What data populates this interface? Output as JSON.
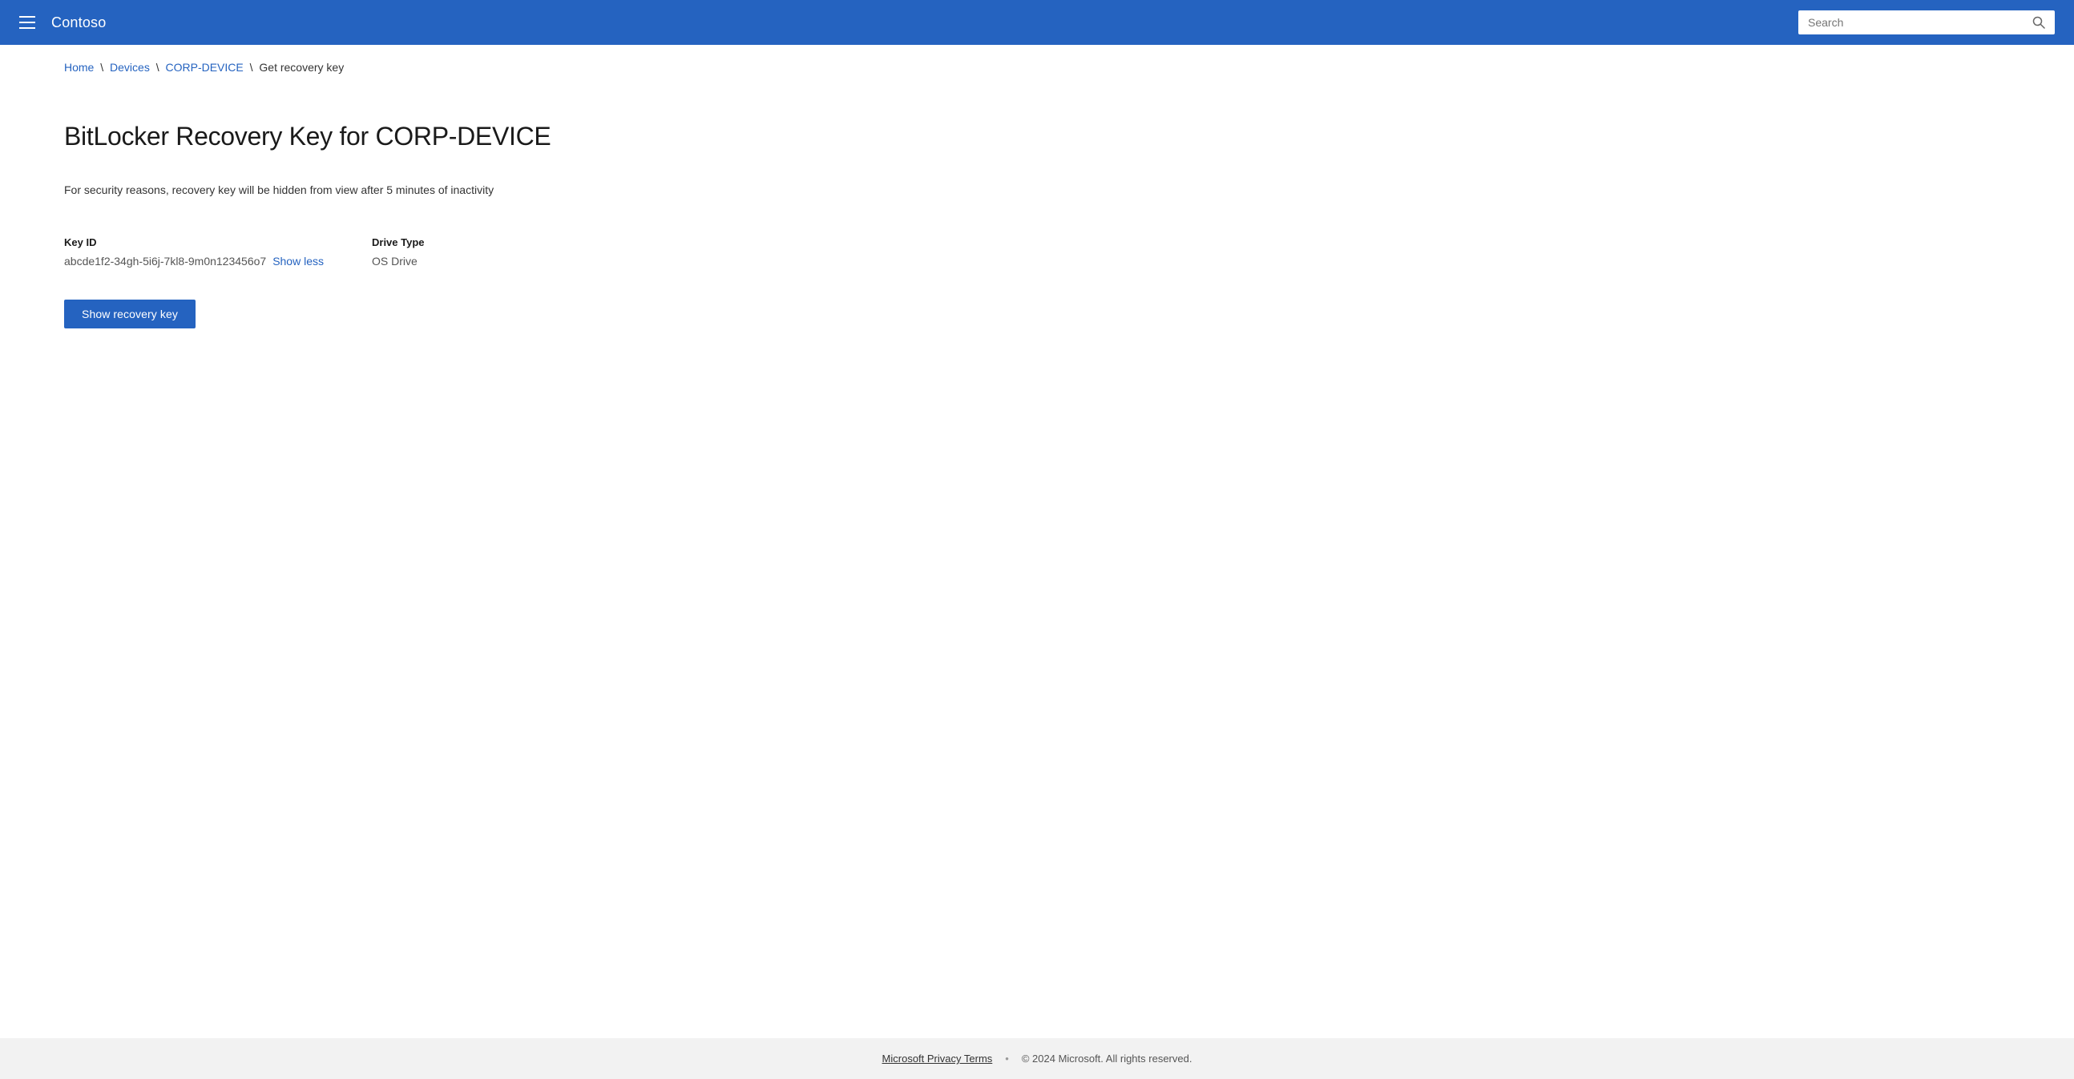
{
  "header": {
    "title": "Contoso",
    "search_placeholder": "Search"
  },
  "breadcrumb": {
    "home": "Home",
    "devices": "Devices",
    "device_name": "CORP-DEVICE",
    "current": "Get recovery key"
  },
  "main": {
    "page_title": "BitLocker Recovery Key for CORP-DEVICE",
    "security_notice": "For security reasons, recovery key will be hidden from view after 5 minutes of inactivity",
    "key_id_label": "Key ID",
    "key_id_value": "abcde1f2-34gh-5i6j-7kl8-9m0n123456o7",
    "show_less_label": "Show less",
    "drive_type_label": "Drive Type",
    "drive_type_value": "OS Drive",
    "show_recovery_btn_label": "Show recovery key"
  },
  "footer": {
    "privacy_link": "Microsoft Privacy Terms",
    "copyright": "© 2024 Microsoft. All rights reserved."
  }
}
